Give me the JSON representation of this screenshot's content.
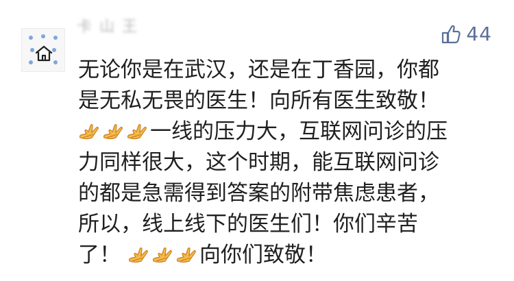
{
  "comment_card": {
    "username": "卡 山 王",
    "likes": {
      "icon": "thumbs-up-icon",
      "count": "44"
    },
    "lines": [
      {
        "text": "无论你是在武汉，还是在丁香园，你都"
      },
      {
        "text": "是无私无畏的医生！向所有医生致敬！"
      },
      {
        "prefix_emoji_count": 3,
        "text": "一线的压力大，互联网问诊的压"
      },
      {
        "text": "力同样很大，这个时期，能互联网问诊"
      },
      {
        "text": "的都是急需得到答案的附带焦虑患者，"
      },
      {
        "text": "所以，线上线下的医生们！你们辛苦"
      },
      {
        "text": "了！",
        "suffix_emoji_count": 3,
        "after_emoji_text": "向你们致敬！"
      }
    ]
  },
  "colors": {
    "text": "#1f1f1f",
    "username": "#b8b8b8",
    "likes": "#5a6f98",
    "emoji_fill": "#f5b94a",
    "emoji_shadow": "#c9801f",
    "avatar_dot": "#7ea6df"
  },
  "icons": {
    "emoji": "folded-hands-icon",
    "avatar": "house-avatar-icon"
  }
}
